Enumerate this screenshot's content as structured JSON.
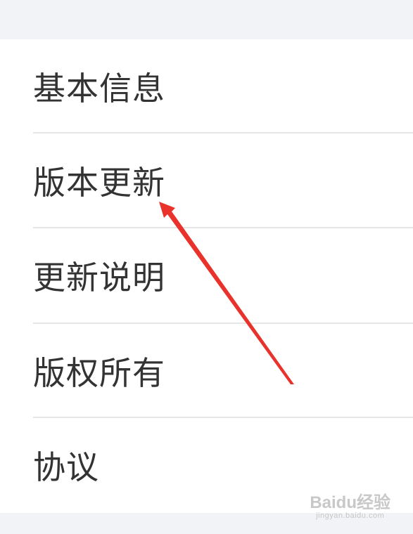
{
  "settings_list": {
    "items": [
      {
        "label": "基本信息"
      },
      {
        "label": "版本更新"
      },
      {
        "label": "更新说明"
      },
      {
        "label": "版权所有"
      },
      {
        "label": "协议"
      }
    ]
  },
  "annotation": {
    "arrow_color": "#e8322b",
    "points_to": "版本更新"
  },
  "watermark": {
    "logo_text": "Baidu经验",
    "url_text": "jingyan.baidu.com"
  }
}
